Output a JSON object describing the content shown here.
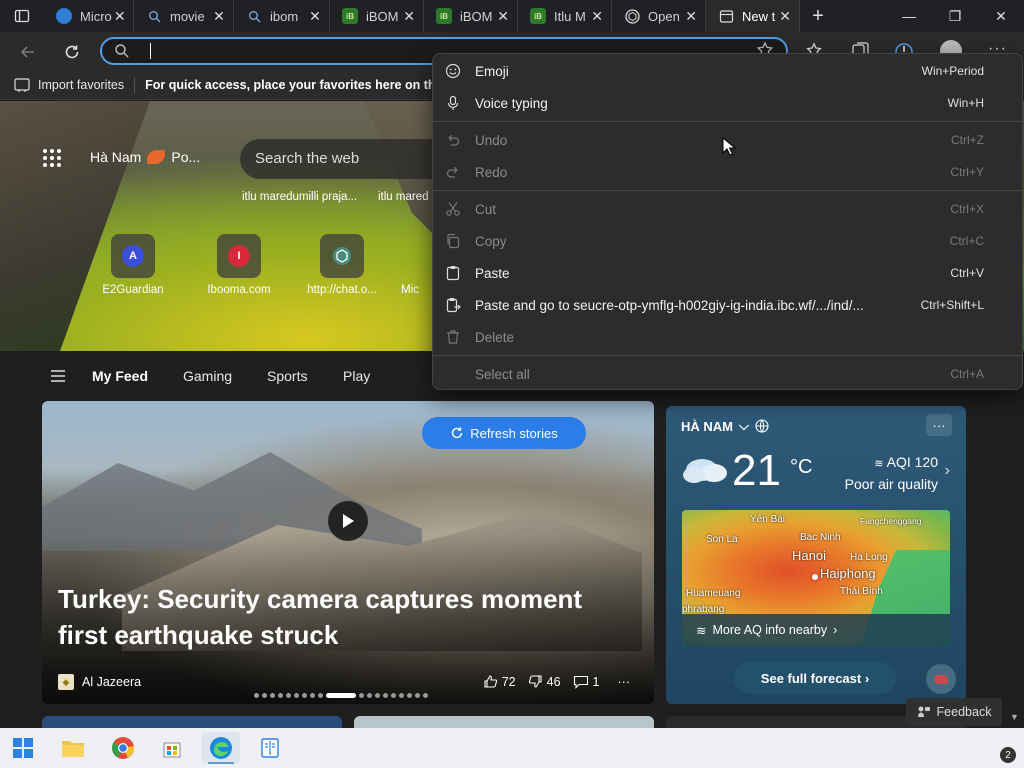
{
  "tabs": [
    {
      "title": "Microsoft Start",
      "short": "Micro",
      "icon": "edge-icon",
      "color": "#2f7fd8",
      "active": false
    },
    {
      "title": "movies",
      "short": "movie",
      "icon": "search-icon",
      "color": "#7aa5e0",
      "active": false
    },
    {
      "title": "ibomma",
      "short": "ibom",
      "icon": "search-icon",
      "color": "#7aa5e0",
      "active": false
    },
    {
      "title": "iBOMMA",
      "short": "iBOM",
      "icon": "ibomma-icon",
      "color": "#2c7a2a",
      "active": false
    },
    {
      "title": "iBOMMA",
      "short": "iBOM",
      "icon": "ibomma-icon",
      "color": "#2c7a2a",
      "active": false
    },
    {
      "title": "Itlu Maredumilli",
      "short": "Itlu M",
      "icon": "ibomma-icon",
      "color": "#2c7a2a",
      "active": false
    },
    {
      "title": "OpenAI",
      "short": "Open",
      "icon": "openai-icon",
      "color": "#444",
      "active": false
    },
    {
      "title": "New tab",
      "short": "New t",
      "icon": "newtab-icon",
      "color": "#888",
      "active": true
    }
  ],
  "favorites_bar": {
    "import_label": "Import favorites",
    "hint": "For quick access, place your favorites here on the favo"
  },
  "hero": {
    "location": "Hà Nam",
    "weather_short": "Po...",
    "search_placeholder": "Search the web",
    "suggestions": [
      "itlu maredumilli praja...",
      "itlu mared"
    ],
    "quick_links": [
      {
        "label": "E2Guardian",
        "letter": "A",
        "color": "#3b4fd8"
      },
      {
        "label": "Ibooma.com",
        "letter": "I",
        "color": "#d8283b"
      },
      {
        "label": "http://chat.o...",
        "letter": "",
        "color": "#4a8c7c"
      },
      {
        "label": "Mic",
        "letter": "",
        "color": "#555"
      }
    ]
  },
  "feed_nav": [
    "My Feed",
    "Gaming",
    "Sports",
    "Play"
  ],
  "story": {
    "refresh_label": "Refresh stories",
    "headline": "Turkey: Security camera captures moment first earthquake struck",
    "source": "Al Jazeera",
    "likes": "72",
    "dislikes": "46",
    "comments": "1"
  },
  "weather": {
    "location": "HÀ NAM",
    "temp": "21",
    "unit": "°C",
    "aqi": "AQI 120",
    "aqi_status": "Poor air quality",
    "map_labels": [
      "Yên Bái",
      "Son La",
      "Bac Ninh",
      "Fangchenggang",
      "Hanoi",
      "Ha Long",
      "Haiphong",
      "Thái Bình",
      "Huameuang",
      "phrabang"
    ],
    "more_aq": "More AQ info nearby",
    "forecast_label": "See full forecast"
  },
  "feedback_label": "Feedback",
  "context_menu": {
    "items": [
      {
        "label": "Emoji",
        "shortcut": "Win+Period",
        "disabled": false,
        "icon": "emoji-icon"
      },
      {
        "label": "Voice typing",
        "shortcut": "Win+H",
        "disabled": false,
        "icon": "microphone-icon"
      },
      {
        "label": "Undo",
        "shortcut": "Ctrl+Z",
        "disabled": true,
        "icon": "undo-icon"
      },
      {
        "label": "Redo",
        "shortcut": "Ctrl+Y",
        "disabled": true,
        "icon": "redo-icon"
      },
      {
        "label": "Cut",
        "shortcut": "Ctrl+X",
        "disabled": true,
        "icon": "scissors-icon"
      },
      {
        "label": "Copy",
        "shortcut": "Ctrl+C",
        "disabled": true,
        "icon": "copy-icon"
      },
      {
        "label": "Paste",
        "shortcut": "Ctrl+V",
        "disabled": false,
        "icon": "paste-icon"
      },
      {
        "label": "Paste and go to seucre-otp-ymflg-h002giy-ig-india.ibc.wf/.../ind/...",
        "shortcut": "Ctrl+Shift+L",
        "disabled": false,
        "icon": "paste-go-icon"
      },
      {
        "label": "Delete",
        "shortcut": "",
        "disabled": true,
        "icon": "trash-icon"
      },
      {
        "label": "Select all",
        "shortcut": "Ctrl+A",
        "disabled": true,
        "icon": ""
      }
    ]
  },
  "taskbar": {
    "notification_count": "2"
  },
  "colors": {
    "accent": "#2b7de9",
    "addr_focus": "#4f9fe8",
    "menu_bg": "#2c2c2c"
  }
}
